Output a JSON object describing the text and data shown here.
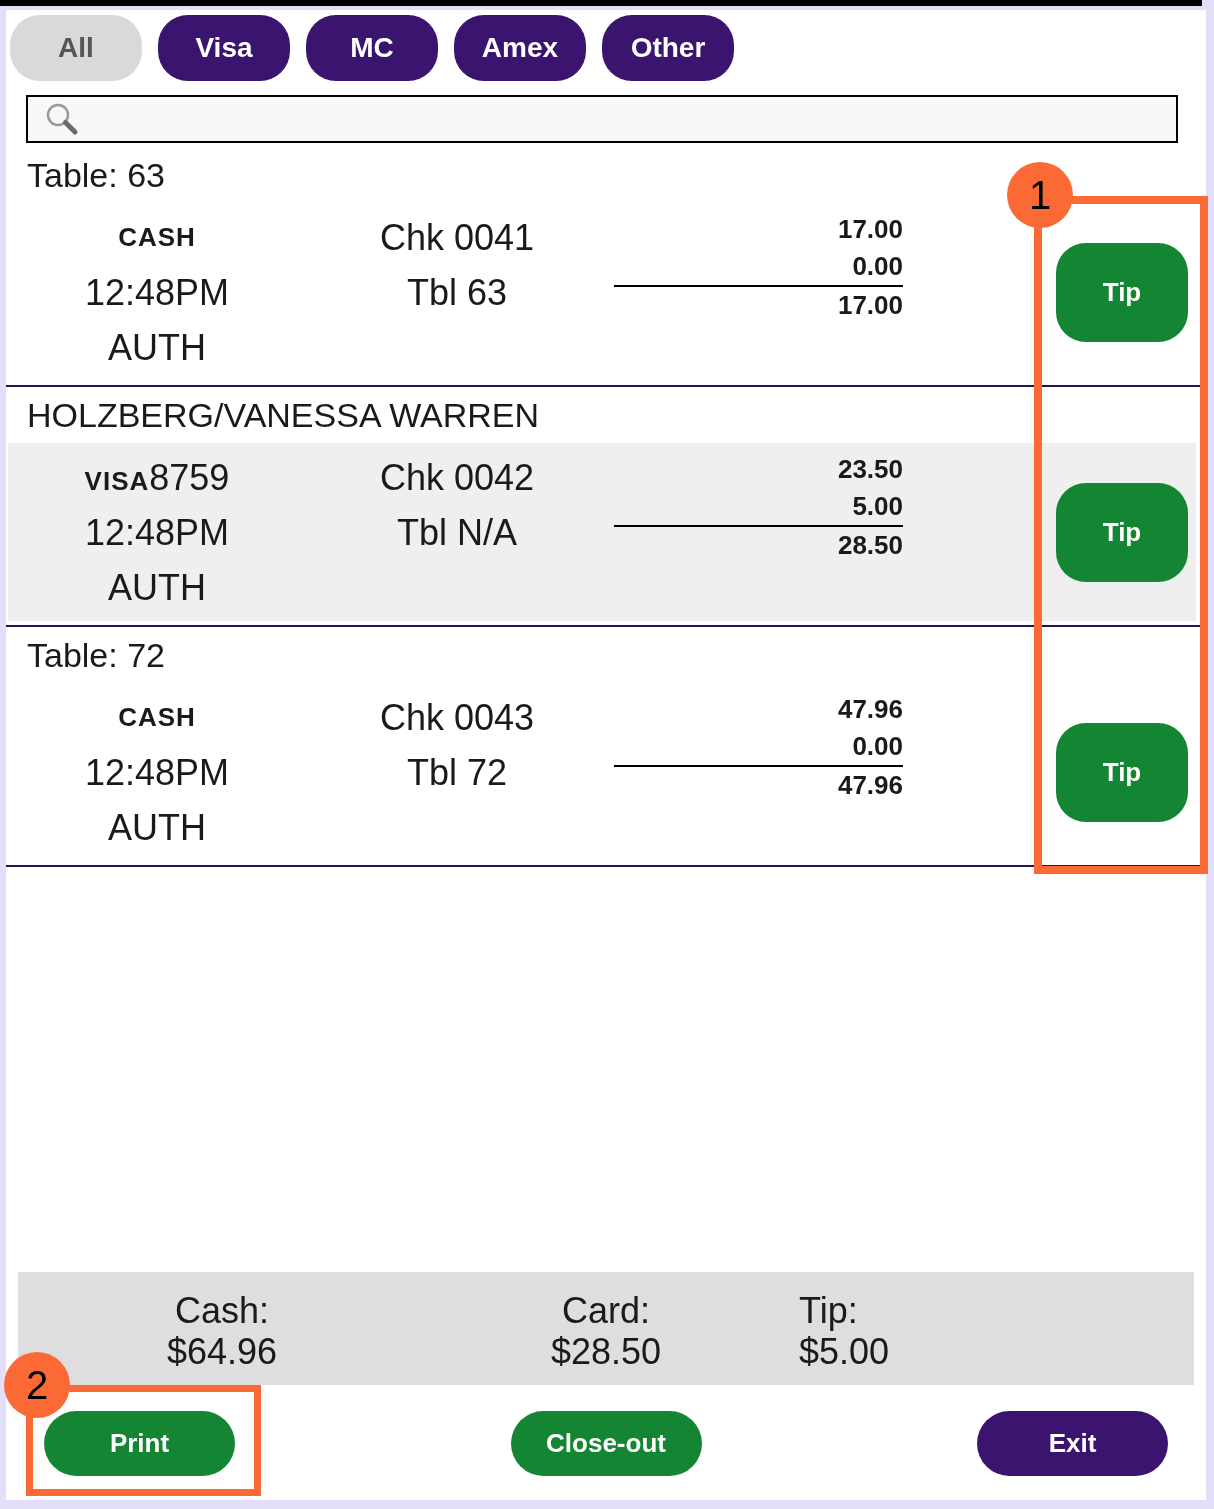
{
  "filters": [
    {
      "label": "All",
      "selected": true
    },
    {
      "label": "Visa",
      "selected": false
    },
    {
      "label": "MC",
      "selected": false
    },
    {
      "label": "Amex",
      "selected": false
    },
    {
      "label": "Other",
      "selected": false
    }
  ],
  "transactions": [
    {
      "heading": "Table: 63",
      "selected": false,
      "tender": "CASH",
      "time": "12:48PM",
      "status": "AUTH",
      "check": "Chk 0041",
      "table": "Tbl 63",
      "amount": "17.00",
      "tip": "0.00",
      "total": "17.00",
      "action": "Tip"
    },
    {
      "heading": "HOLZBERG/VANESSA WARREN",
      "selected": true,
      "tender": "VISA",
      "card_number": "8759",
      "time": "12:48PM",
      "status": "AUTH",
      "check": "Chk 0042",
      "table": "Tbl N/A",
      "amount": "23.50",
      "tip": "5.00",
      "total": "28.50",
      "action": "Tip"
    },
    {
      "heading": "Table: 72",
      "selected": false,
      "tender": "CASH",
      "time": "12:48PM",
      "status": "AUTH",
      "check": "Chk 0043",
      "table": "Tbl 72",
      "amount": "47.96",
      "tip": "0.00",
      "total": "47.96",
      "action": "Tip"
    }
  ],
  "summary": [
    {
      "label": "Cash:",
      "value": "$64.96"
    },
    {
      "label": "Card:",
      "value": "$28.50"
    },
    {
      "label": "Tip:",
      "value": "$5.00"
    }
  ],
  "buttons": [
    {
      "label": "Print",
      "color": "#148532"
    },
    {
      "label": "Close-out",
      "color": "#148532"
    },
    {
      "label": "Exit",
      "color": "#3b1470"
    }
  ],
  "annotations": [
    {
      "label": "1"
    },
    {
      "label": "2"
    }
  ]
}
